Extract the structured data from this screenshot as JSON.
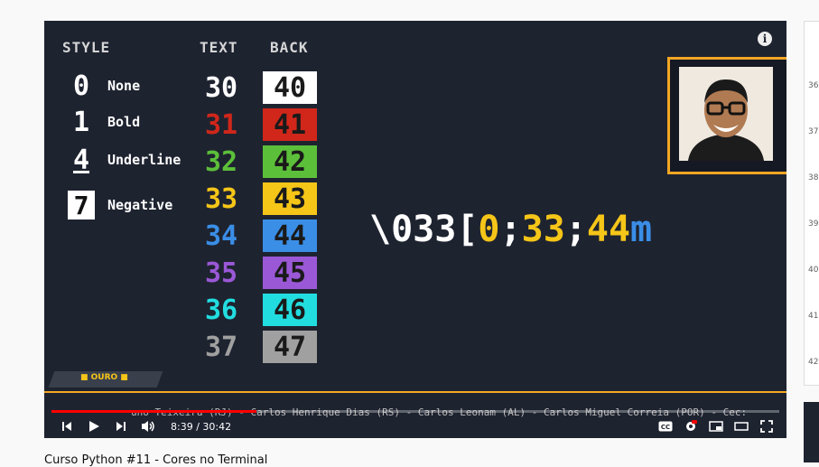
{
  "video": {
    "style_header": "STYLE",
    "text_header": "TEXT",
    "back_header": "BACK",
    "styles": [
      {
        "code": "0",
        "label": "None"
      },
      {
        "code": "1",
        "label": "Bold"
      },
      {
        "code": "4",
        "label": "Underline"
      },
      {
        "code": "7",
        "label": "Negative"
      }
    ],
    "text_codes": [
      "30",
      "31",
      "32",
      "33",
      "34",
      "35",
      "36",
      "37"
    ],
    "back_codes": [
      "40",
      "41",
      "42",
      "43",
      "44",
      "45",
      "46",
      "47"
    ],
    "text_colors": [
      "#ffffff",
      "#d0271a",
      "#5cbf3a",
      "#f5c518",
      "#3a8ee6",
      "#9a58d6",
      "#22dde0",
      "#a0a0a0"
    ],
    "back_colors": [
      "#ffffff",
      "#d0271a",
      "#5cbf3a",
      "#f5c518",
      "#3a8ee6",
      "#9a58d6",
      "#22dde0",
      "#a0a0a0"
    ],
    "sequence": {
      "esc": "\\033",
      "bracket": "[",
      "style": "0",
      "sep1": ";",
      "text": "33",
      "sep2": ";",
      "back": "44",
      "end": "m"
    },
    "sequence_colors": {
      "esc": "#ffffff",
      "num": "#f5a623",
      "bracket": "#ffffff",
      "style": "#f5c518",
      "sep": "#ffffff",
      "text": "#f5c518",
      "back": "#f5c518",
      "end": "#3a8ee6"
    },
    "badge_label": "■ OURO ■",
    "ticker": "uno Teixeira (RJ) - Carlos Henrique Dias (RS) - Carlos Leonam (AL) - Carlos Miguel Correia (POR) - Cec:",
    "info_icon": "i"
  },
  "controls": {
    "time": "8:39 / 30:42",
    "progress": 0.282,
    "icons": [
      "previous-icon",
      "play-icon",
      "next-icon",
      "volume-icon",
      "cc-icon",
      "settings-icon",
      "miniplayer-icon",
      "theater-icon",
      "fullscreen-icon"
    ]
  },
  "title": "Curso Python #11 - Cores no Terminal",
  "sidebar": {
    "numbers": [
      "36",
      "37",
      "38",
      "39",
      "40",
      "41",
      "42"
    ]
  }
}
